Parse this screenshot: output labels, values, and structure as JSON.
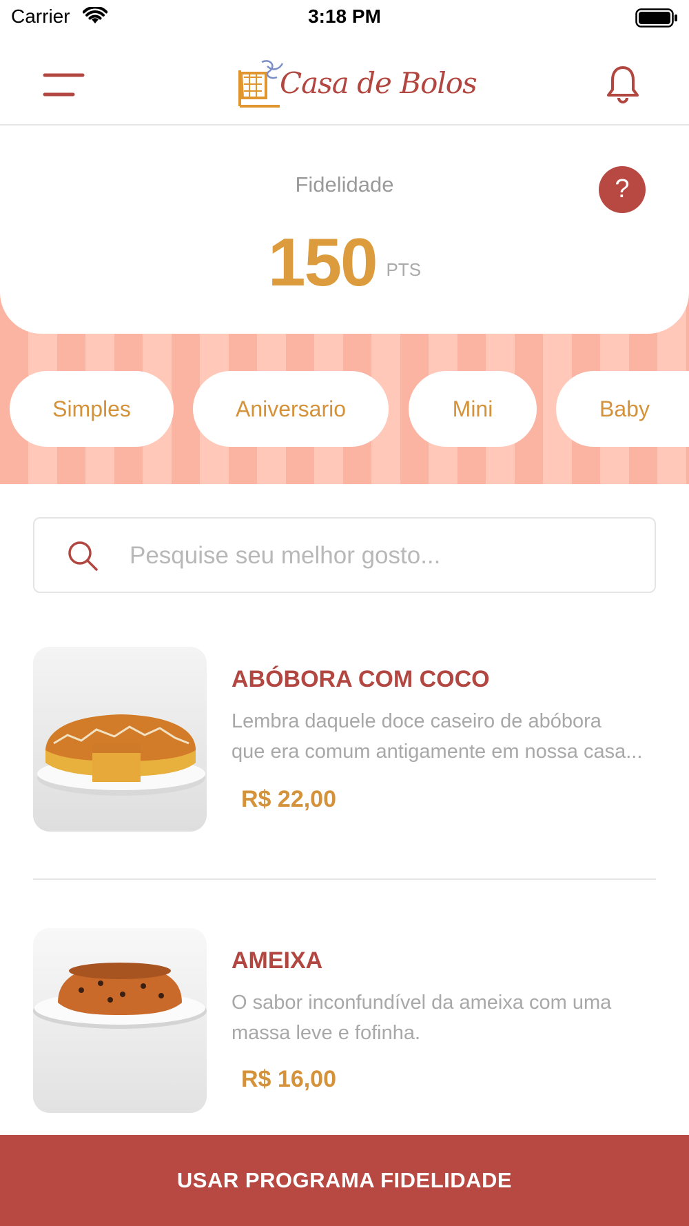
{
  "status_bar": {
    "carrier": "Carrier",
    "time": "3:18 PM"
  },
  "header": {
    "brand": "Casa de Bolos",
    "menu_icon": "menu-icon",
    "notification_icon": "bell-icon"
  },
  "loyalty": {
    "label": "Fidelidade",
    "points": "150",
    "unit": "PTS",
    "help_symbol": "?"
  },
  "categories": [
    {
      "label": "Simples"
    },
    {
      "label": "Aniversario"
    },
    {
      "label": "Mini"
    },
    {
      "label": "Baby"
    }
  ],
  "search": {
    "placeholder": "Pesquise seu melhor gosto...",
    "value": "",
    "icon": "search-icon"
  },
  "products": [
    {
      "name": "ABÓBORA COM COCO",
      "description_lines": [
        "Lembra daquele doce caseiro de abóbora",
        "que era comum antigamente em nossa casa..."
      ],
      "price": "R$ 22,00"
    },
    {
      "name": "AMEIXA",
      "description_lines": [
        "O sabor inconfundível da ameixa com uma",
        "massa leve e fofinha."
      ],
      "price": "R$ 16,00"
    }
  ],
  "cta": {
    "label": "USAR PROGRAMA FIDELIDADE"
  },
  "colors": {
    "brand_red": "#b84842",
    "accent_gold": "#dc9b3c",
    "stripe_dark": "#fbb4a2",
    "stripe_light": "#ffc8b8"
  }
}
